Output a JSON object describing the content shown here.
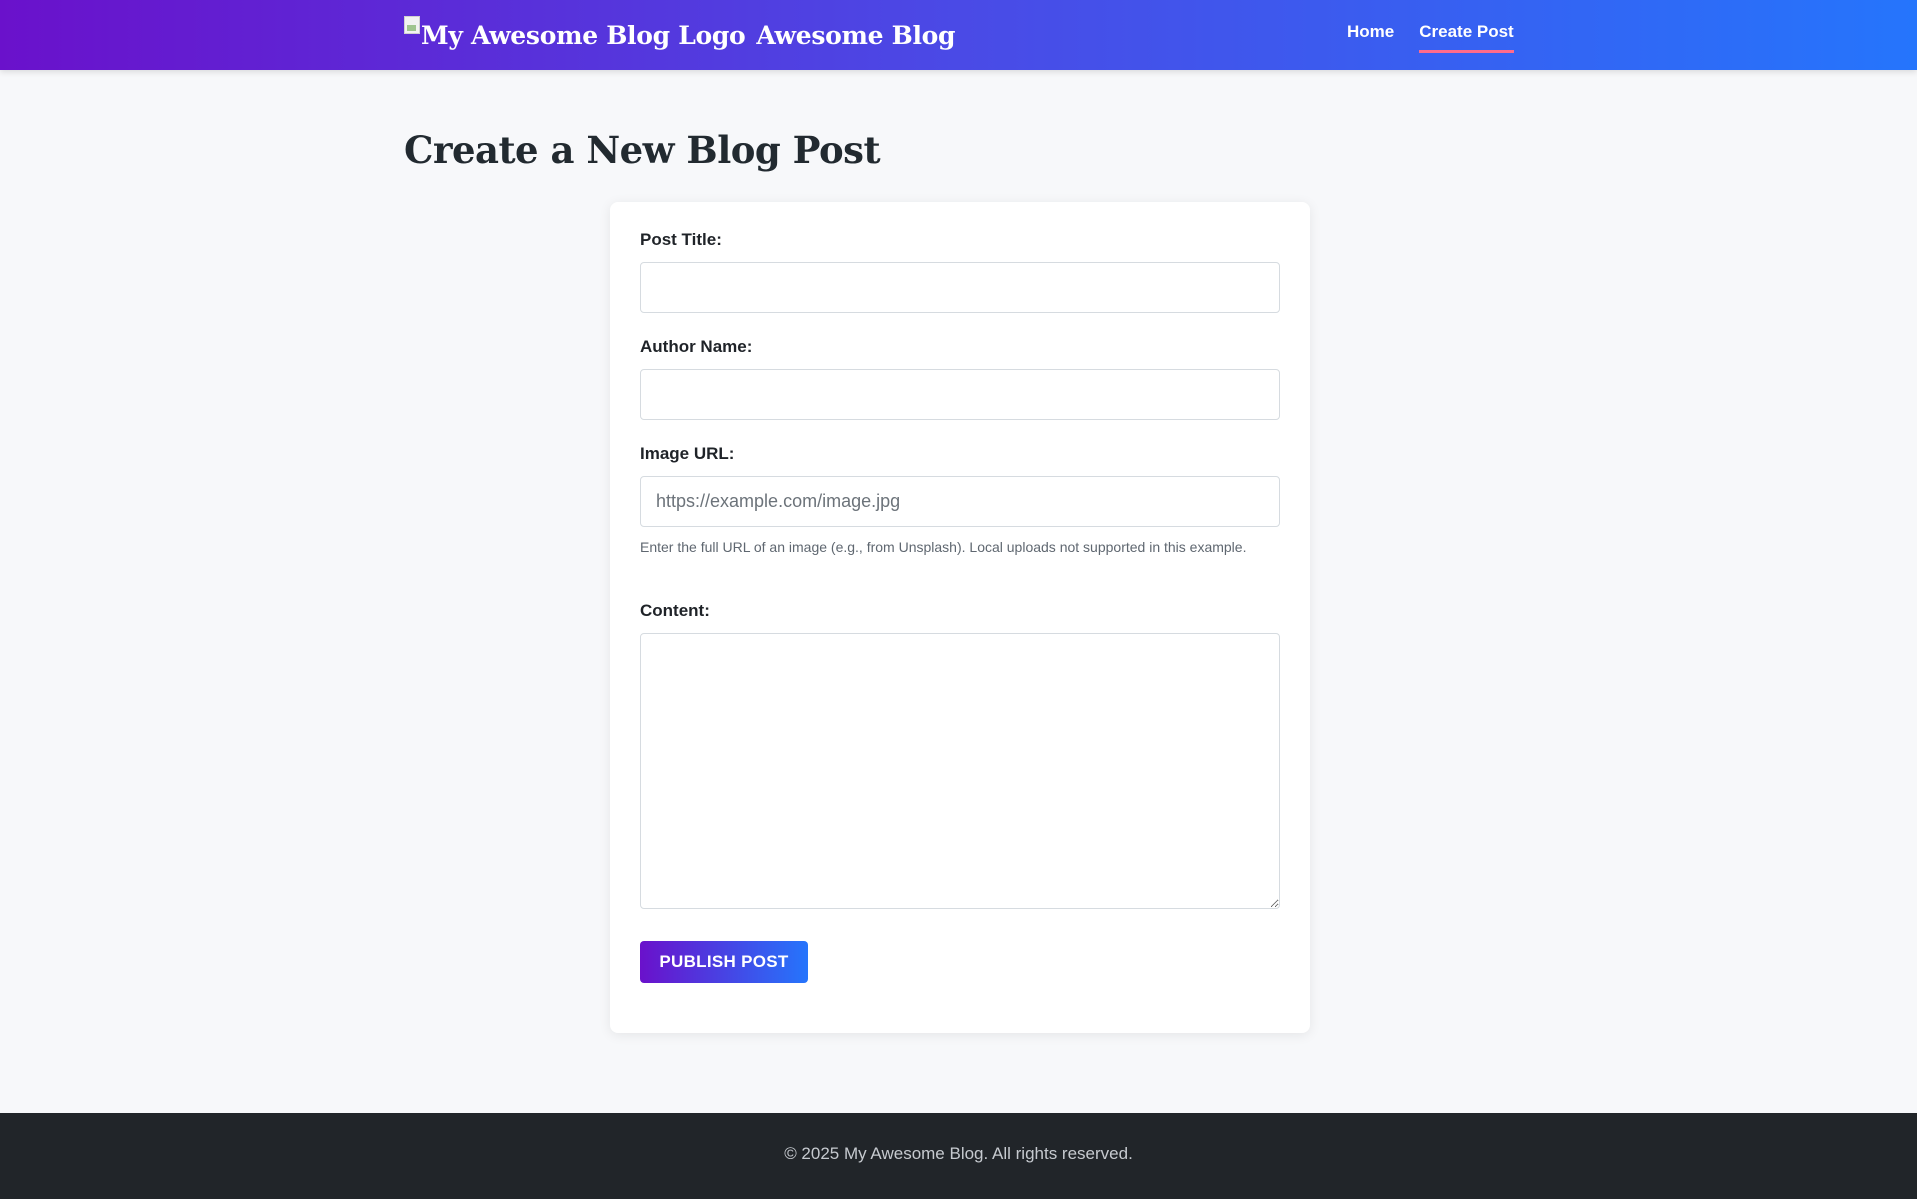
{
  "header": {
    "logo_alt": "My Awesome Blog Logo",
    "brand_name": "Awesome Blog",
    "nav": [
      {
        "label": "Home",
        "active": false
      },
      {
        "label": "Create Post",
        "active": true
      }
    ],
    "gradient_start": "#6a11cb",
    "gradient_end": "#2575fc",
    "active_underline_color": "#ff6b8b"
  },
  "page": {
    "title": "Create a New Blog Post"
  },
  "form": {
    "post_title": {
      "label": "Post Title:",
      "value": "",
      "placeholder": ""
    },
    "author_name": {
      "label": "Author Name:",
      "value": "",
      "placeholder": ""
    },
    "image_url": {
      "label": "Image URL:",
      "value": "",
      "placeholder": "https://example.com/image.jpg",
      "help": "Enter the full URL of an image (e.g., from Unsplash). Local uploads not supported in this example."
    },
    "content": {
      "label": "Content:",
      "value": ""
    },
    "submit_label": "Publish Post"
  },
  "footer": {
    "text": "© 2025 My Awesome Blog. All rights reserved."
  }
}
